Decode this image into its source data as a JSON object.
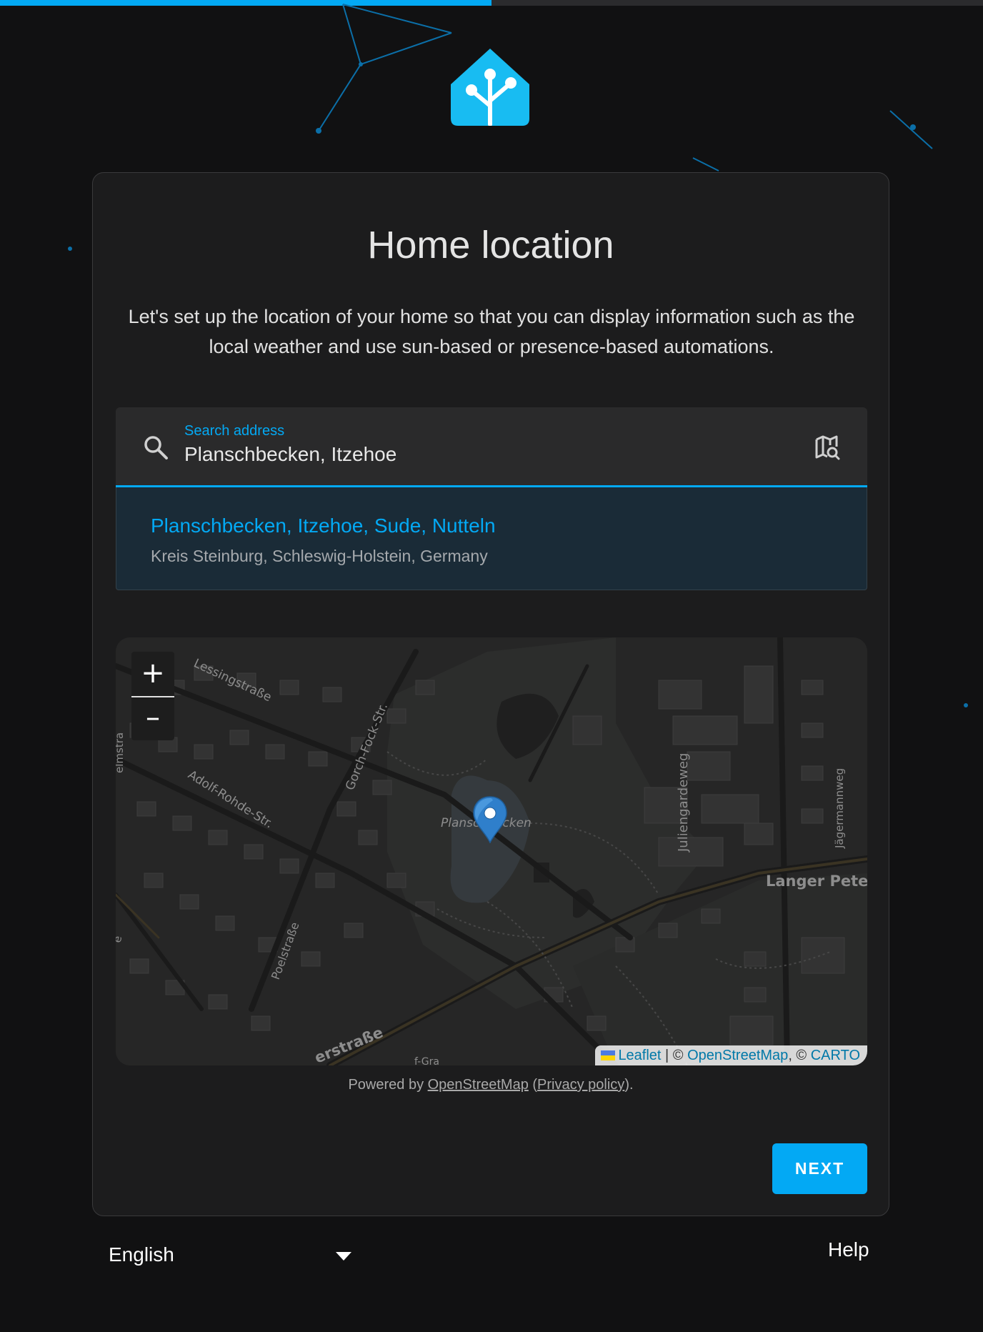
{
  "progress": {
    "value_percent": 50
  },
  "colors": {
    "accent": "#03a9f4",
    "background": "#111112",
    "card": "#1c1c1d"
  },
  "logo": {
    "icon": "home-assistant-logo-icon"
  },
  "card": {
    "title": "Home location",
    "intro": "Let's set up the location of your home so that you can display information such as the local weather and use sun-based or presence-based automations."
  },
  "search": {
    "label": "Search address",
    "value": "Planschbecken, Itzehoe",
    "leading_icon": "search-icon",
    "trailing_icon": "map-search-icon"
  },
  "suggestion": {
    "primary": "Planschbecken, Itzehoe, Sude, Nutteln",
    "secondary": "Kreis Steinburg, Schleswig-Holstein, Germany"
  },
  "map": {
    "zoom_in": "+",
    "zoom_out": "–",
    "marker_icon": "map-pin-icon",
    "labels": {
      "lessing": "Lessingstraße",
      "gorch": "Gorch-Fock-Str.",
      "adolf": "Adolf-Rohde-Str.",
      "poel": "Poelstraße",
      "julien": "Juliengardeweg",
      "jaeger": "Jägermannweg",
      "langer": "Langer Pete",
      "planschbecken": "Planschbecken",
      "wilhelm": "elmstra",
      "bottom_street": "erstraße",
      "bottom_cut": "f-Gra",
      "left_cut": "e"
    },
    "attribution": {
      "leaflet": "Leaflet",
      "sep1": " | © ",
      "osm": "OpenStreetMap",
      "sep2": ", © ",
      "carto": "CARTO"
    }
  },
  "powered": {
    "prefix": "Powered by ",
    "link": "OpenStreetMap",
    "open_paren": " (",
    "privacy": "Privacy policy",
    "close": ")."
  },
  "next_button": "NEXT",
  "footer": {
    "language": "English",
    "help": "Help"
  }
}
